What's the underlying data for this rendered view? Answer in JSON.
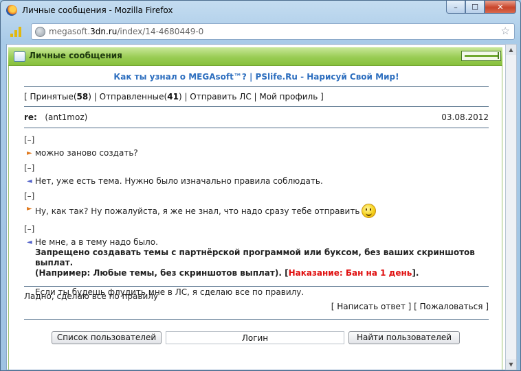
{
  "window": {
    "title": "Личные сообщения - Mozilla Firefox",
    "min_glyph": "–",
    "max_glyph": "☐",
    "close_glyph": "✕"
  },
  "address": {
    "url_prefix": "megasoft.",
    "url_domain": "3dn.ru",
    "url_path": "/index/14-4680449-0"
  },
  "panel": {
    "title": "Личные сообщения"
  },
  "promo": {
    "left": "Как ты узнал о MEGAsoft™?",
    "separator": " | ",
    "right": "PSlife.Ru - Нарисуй Свой Мир!"
  },
  "nav": {
    "open": "[ ",
    "inbox_label": "Принятые",
    "inbox_count": "58",
    "sent_label": "Отправленные",
    "sent_count": "41",
    "send_label": "Отправить ЛС",
    "profile_label": "Мой профиль",
    "close": " ]",
    "sep": " | "
  },
  "message": {
    "subject_prefix": "re:",
    "from": "(ant1moz)",
    "date": "03.08.2012"
  },
  "thread": {
    "toggle": "[–]",
    "line1": "можно заново создать?",
    "line2": "Нет, уже есть тема. Нужно было изначально правила соблюдать.",
    "line3": "Ну, как так? Ну пожалуйста, я же не знал, что надо сразу тебе отправить",
    "line4": "Не мне, а в тему надо было.",
    "rules1": "Запрещено создавать темы с партнёрской программой или буксом, без ваших скриншотов выплат.",
    "rules2_pre": "(Например: Любые темы, без скриншотов выплат). [",
    "rules2_red": "Наказание: Бан на 1 день",
    "rules2_post": "].",
    "final": "Если ты будешь флудить мне в ЛС, я сделаю все по правилу."
  },
  "reply": {
    "text": "Ладно, сделаю все по правилу",
    "write_label": "Написать ответ",
    "complain_label": "Пожаловаться"
  },
  "bottom": {
    "users_button": "Список пользователей",
    "login_placeholder": "Логин",
    "find_button": "Найти пользователей"
  },
  "colors": {
    "panel_green": "#9acd55",
    "link_blue": "#2e6fbf",
    "penalty_red": "#e01010"
  }
}
